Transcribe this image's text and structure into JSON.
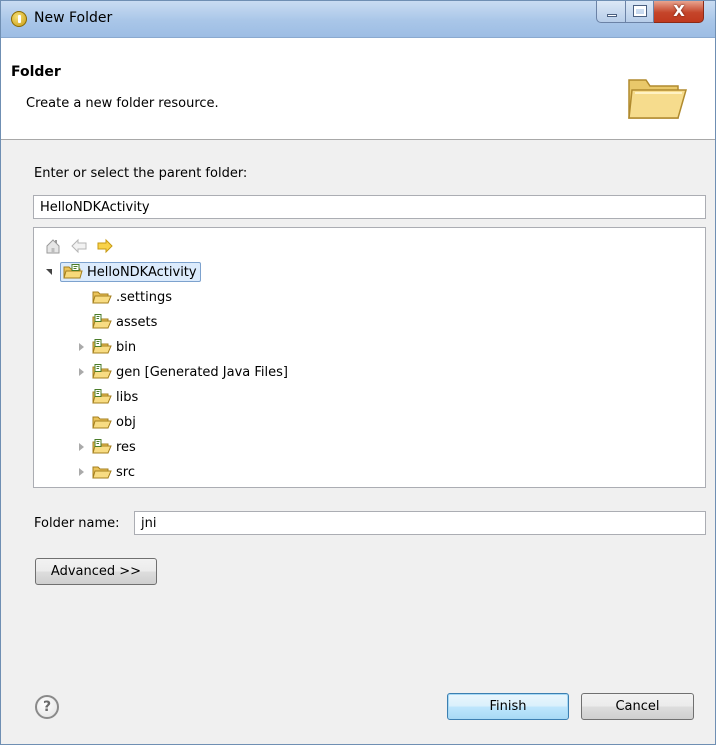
{
  "window": {
    "title": "New Folder",
    "controls": {
      "minimize": "minimize",
      "maximize": "maximize",
      "close": "X"
    }
  },
  "header": {
    "title": "Folder",
    "description": "Create a new folder resource."
  },
  "parent": {
    "label": "Enter or select the parent folder:",
    "value": "HelloNDKActivity"
  },
  "tree": {
    "toolbar": [
      "home-icon",
      "back-arrow-icon",
      "forward-arrow-icon"
    ],
    "root": {
      "label": "HelloNDKActivity",
      "expanded": true,
      "selected": true
    },
    "items": [
      {
        "label": ".settings",
        "expandable": false,
        "icon": "folder-icon"
      },
      {
        "label": "assets",
        "expandable": false,
        "icon": "source-folder-icon"
      },
      {
        "label": "bin",
        "expandable": true,
        "icon": "source-folder-icon"
      },
      {
        "label": "gen [Generated Java Files]",
        "expandable": true,
        "icon": "source-folder-icon"
      },
      {
        "label": "libs",
        "expandable": false,
        "icon": "source-folder-icon"
      },
      {
        "label": "obj",
        "expandable": false,
        "icon": "folder-icon"
      },
      {
        "label": "res",
        "expandable": true,
        "icon": "source-folder-icon"
      },
      {
        "label": "src",
        "expandable": true,
        "icon": "folder-icon"
      }
    ]
  },
  "folder_name": {
    "label": "Folder name:",
    "value": "jni"
  },
  "buttons": {
    "advanced": "Advanced >>",
    "finish": "Finish",
    "cancel": "Cancel",
    "help": "?"
  },
  "colors": {
    "titlebar": "#a9c6e8",
    "close_button": "#c5452a",
    "selection": "#dcebfc",
    "folder": "#f2c94c"
  }
}
